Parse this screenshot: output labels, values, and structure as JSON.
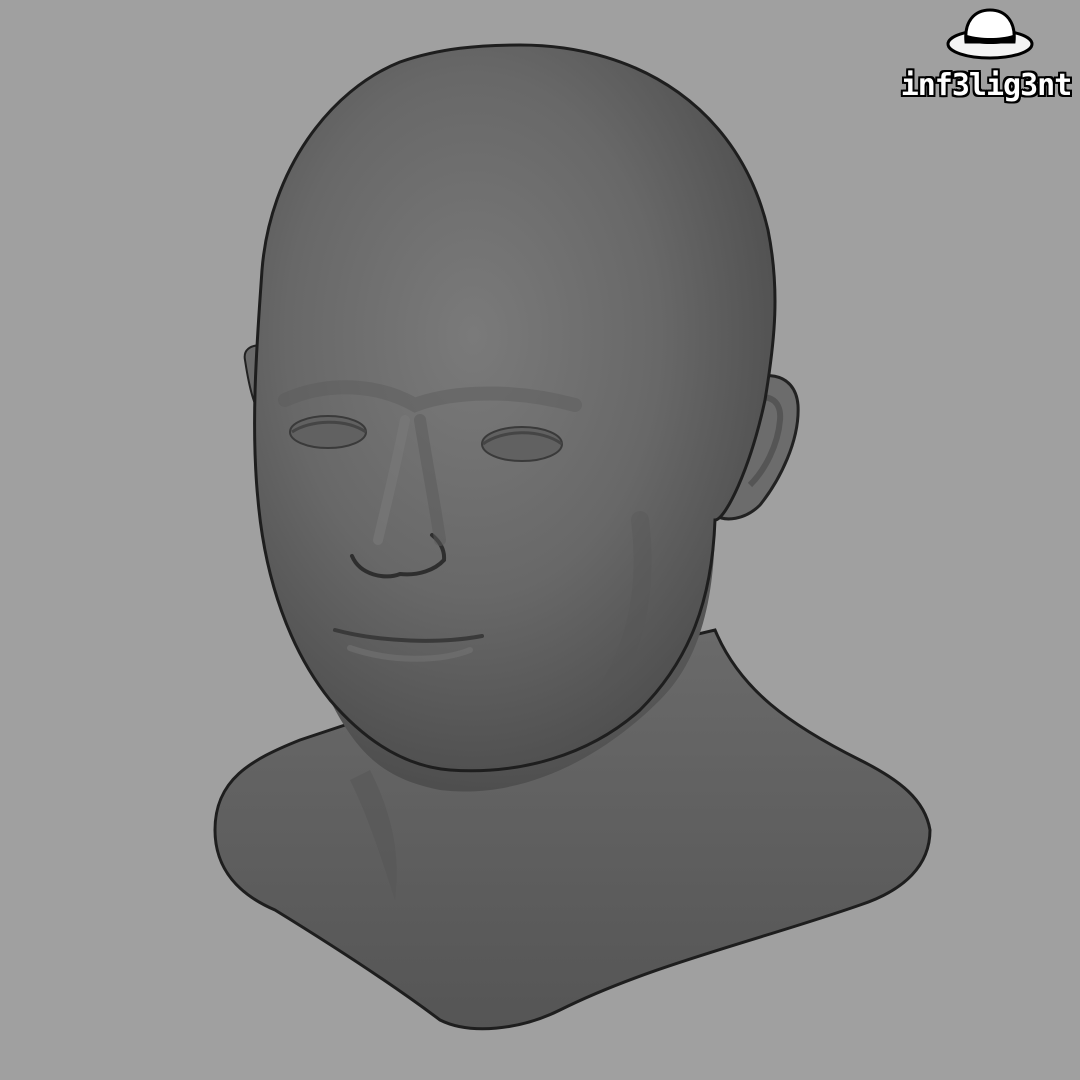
{
  "scene": {
    "subject": "3d-head-bust",
    "background_color": "#a0a0a0",
    "model_color": "#666666"
  },
  "watermark": {
    "text": "inf3lig3nt",
    "icon": "fedora-hat-icon"
  }
}
